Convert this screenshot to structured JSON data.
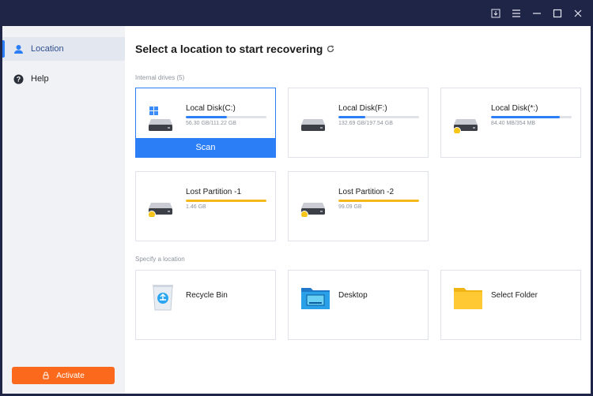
{
  "sidebar": {
    "items": [
      {
        "label": "Location",
        "icon": "location-icon",
        "active": true
      },
      {
        "label": "Help",
        "icon": "help-icon",
        "active": false
      }
    ],
    "activate_label": "Activate"
  },
  "header": {
    "title": "Select a location to start recovering"
  },
  "internal": {
    "label": "Internal drives (5)",
    "drives": [
      {
        "name": "Local Disk(C:)",
        "size": "56.30 GB/111.22 GB",
        "usage": 0.51,
        "bar_color": "#2c7ef7",
        "selected": true,
        "scan_label": "Scan"
      },
      {
        "name": "Local Disk(F:)",
        "size": "132.69 GB/197.54 GB",
        "usage": 0.33,
        "bar_color": "#2c7ef7"
      },
      {
        "name": "Local Disk(*:)",
        "size": "84.40 MB/354 MB",
        "usage": 0.85,
        "bar_color": "#2c7ef7"
      },
      {
        "name": "Lost Partition -1",
        "size": "1.46 GB",
        "usage": 1.0,
        "bar_color": "#f5b91c"
      },
      {
        "name": "Lost Partition -2",
        "size": "99.09 GB",
        "usage": 1.0,
        "bar_color": "#f5b91c"
      }
    ]
  },
  "specify": {
    "label": "Specify a location",
    "items": [
      {
        "label": "Recycle Bin",
        "icon": "recycle-bin-icon"
      },
      {
        "label": "Desktop",
        "icon": "desktop-folder-icon"
      },
      {
        "label": "Select Folder",
        "icon": "folder-icon"
      }
    ]
  },
  "colors": {
    "accent": "#2c7ef7",
    "activate": "#fb6a1c",
    "titlebar": "#1f2546",
    "lost_partition": "#f5b91c"
  }
}
